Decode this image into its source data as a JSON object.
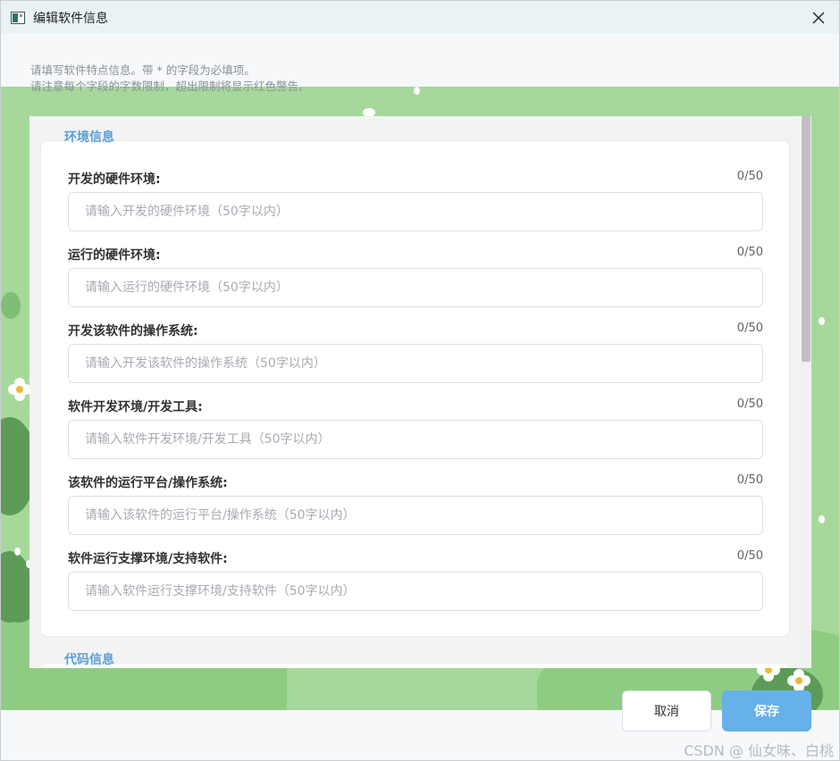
{
  "window": {
    "title": "编辑软件信息"
  },
  "notice": {
    "line1": "请填写软件特点信息。带 * 的字段为必填项。",
    "line2": "请注意每个字段的字数限制，超出限制将显示红色警告。"
  },
  "sections": [
    {
      "title": "环境信息",
      "fields": [
        {
          "label": "开发的硬件环境:",
          "count": "0/50",
          "value": "",
          "placeholder": "请输入开发的硬件环境（50字以内）"
        },
        {
          "label": "运行的硬件环境:",
          "count": "0/50",
          "value": "",
          "placeholder": "请输入运行的硬件环境（50字以内）"
        },
        {
          "label": "开发该软件的操作系统:",
          "count": "0/50",
          "value": "",
          "placeholder": "请输入开发该软件的操作系统（50字以内）"
        },
        {
          "label": "软件开发环境/开发工具:",
          "count": "0/50",
          "value": "",
          "placeholder": "请输入软件开发环境/开发工具（50字以内）"
        },
        {
          "label": "该软件的运行平台/操作系统:",
          "count": "0/50",
          "value": "",
          "placeholder": "请输入该软件的运行平台/操作系统（50字以内）"
        },
        {
          "label": "软件运行支撑环境/支持软件:",
          "count": "0/50",
          "value": "",
          "placeholder": "请输入软件运行支撑环境/支持软件（50字以内）"
        }
      ]
    },
    {
      "title": "代码信息"
    }
  ],
  "buttons": {
    "cancel": "取消",
    "save": "保存"
  },
  "watermark": "CSDN @  仙女味、白桃",
  "colors": {
    "accent": "#66b1e8",
    "section_title": "#5a9fd6",
    "background_green": "#a6d89b"
  }
}
